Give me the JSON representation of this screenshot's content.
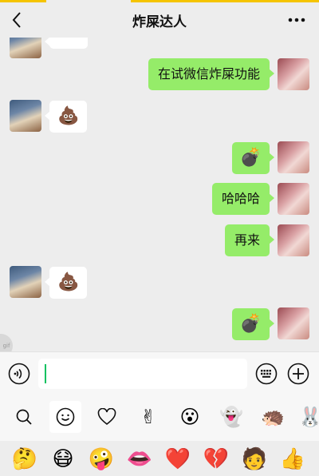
{
  "header": {
    "title": "炸屎达人",
    "back_icon": "chevron-left-icon",
    "more_icon": "more-dots-icon"
  },
  "messages": [
    {
      "side": "other",
      "type": "image",
      "partial": true
    },
    {
      "side": "me",
      "type": "text",
      "text": "在试微信炸屎功能"
    },
    {
      "side": "other",
      "type": "emoji",
      "emoji": "💩"
    },
    {
      "side": "me",
      "type": "emoji",
      "emoji": "💣"
    },
    {
      "side": "me",
      "type": "text",
      "text": "哈哈哈"
    },
    {
      "side": "me",
      "type": "text",
      "text": "再来"
    },
    {
      "side": "other",
      "type": "emoji",
      "emoji": "💩"
    },
    {
      "side": "me",
      "type": "emoji",
      "emoji": "💣"
    }
  ],
  "side_tab": {
    "label": "gif"
  },
  "input_bar": {
    "voice_icon": "voice-icon",
    "text_value": "",
    "keyboard_icon": "keyboard-icon",
    "plus_icon": "plus-icon"
  },
  "emoji_tabs": [
    {
      "name": "search-icon",
      "glyph": "⌕"
    },
    {
      "name": "smiley-icon",
      "glyph": "☺",
      "active": true
    },
    {
      "name": "heart-outline-icon",
      "glyph": "♡"
    },
    {
      "name": "victory-hand-icon",
      "glyph": "✌"
    },
    {
      "name": "sticker-surprised-icon",
      "glyph": "😮"
    },
    {
      "name": "sticker-ghost-icon",
      "glyph": "👻"
    },
    {
      "name": "sticker-hedgehog-icon",
      "glyph": "🦔"
    },
    {
      "name": "sticker-rabbit-icon",
      "glyph": "🐰"
    }
  ],
  "emoji_panel": [
    "🤔",
    "😷",
    "🤪",
    "👄",
    "❤️",
    "💔",
    "🧑",
    "👍"
  ],
  "colors": {
    "accent_top": "#f5c400",
    "my_bubble": "#95ec69",
    "other_bubble": "#ffffff",
    "background": "#ededed",
    "caret": "#07c160"
  }
}
